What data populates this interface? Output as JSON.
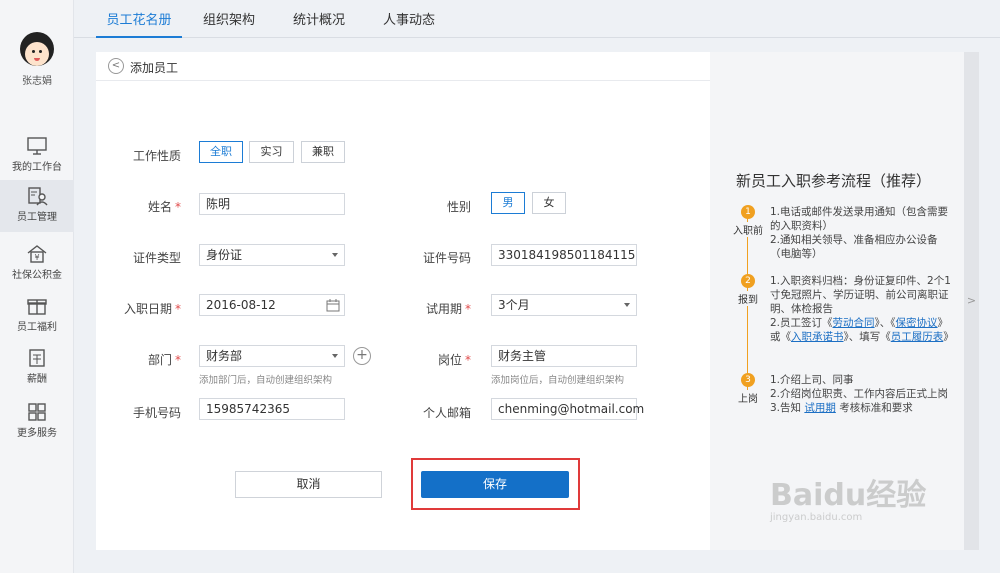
{
  "user": {
    "name": "张志娟"
  },
  "sidebar": {
    "items": [
      {
        "label": "我的工作台",
        "icon": "monitor-icon"
      },
      {
        "label": "员工管理",
        "icon": "employee-icon"
      },
      {
        "label": "社保公积金",
        "icon": "house-yen-icon"
      },
      {
        "label": "员工福利",
        "icon": "gift-icon"
      },
      {
        "label": "薪酬",
        "icon": "wallet-icon"
      },
      {
        "label": "更多服务",
        "icon": "grid-icon"
      }
    ]
  },
  "tabs": [
    {
      "label": "员工花名册"
    },
    {
      "label": "组织架构"
    },
    {
      "label": "统计概况"
    },
    {
      "label": "人事动态"
    }
  ],
  "panel": {
    "title": "添加员工"
  },
  "form": {
    "work_type": {
      "label": "工作性质",
      "options": [
        "全职",
        "实习",
        "兼职"
      ],
      "selected": "全职"
    },
    "name": {
      "label": "姓名",
      "value": "陈明"
    },
    "gender": {
      "label": "性别",
      "options": [
        "男",
        "女"
      ],
      "selected": "男"
    },
    "id_type": {
      "label": "证件类型",
      "value": "身份证"
    },
    "id_number": {
      "label": "证件号码",
      "value": "330184198501184115"
    },
    "hire_date": {
      "label": "入职日期",
      "value": "2016-08-12"
    },
    "probation": {
      "label": "试用期",
      "value": "3个月"
    },
    "department": {
      "label": "部门",
      "value": "财务部",
      "hint": "添加部门后，自动创建组织架构"
    },
    "position": {
      "label": "岗位",
      "value": "财务主管",
      "hint": "添加岗位后，自动创建组织架构"
    },
    "phone": {
      "label": "手机号码",
      "value": "15985742365"
    },
    "email": {
      "label": "个人邮箱",
      "value": "chenming@hotmail.com"
    },
    "cancel_label": "取消",
    "save_label": "保存"
  },
  "guide": {
    "title": "新员工入职参考流程（推荐）",
    "steps": [
      {
        "num": "1",
        "name": "入职前"
      },
      {
        "num": "2",
        "name": "报到"
      },
      {
        "num": "3",
        "name": "上岗"
      }
    ],
    "s1": {
      "l1": "1.电话或邮件发送录用通知（包含需要的入职资料）",
      "l2": "2.通知相关领导、准备相应办公设备（电脑等）"
    },
    "s2": {
      "l1": "1.入职资料归档：身份证复印件、2个1寸免冠照片、学历证明、前公司离职证明、体检报告",
      "l2a": "2.员工签订《",
      "link1": "劳动合同",
      "l2b": "》、《",
      "link2": "保密协议",
      "l2c": "》或《",
      "link3": "入职承诺书",
      "l2d": "》、填写《",
      "link4": "员工履历表",
      "l2e": "》"
    },
    "s3": {
      "l1": "1.介绍上司、同事",
      "l2": "2.介绍岗位职责、工作内容后正式上岗",
      "l3a": "3.告知 ",
      "link": "试用期",
      "l3b": " 考核标准和要求"
    }
  },
  "watermark": {
    "main": "Baidu经验",
    "sub": "jingyan.baidu.com"
  },
  "colors": {
    "accent": "#1c7cd5",
    "save": "#1470c8",
    "highlight": "#e03a3a",
    "step": "#f0a020"
  }
}
